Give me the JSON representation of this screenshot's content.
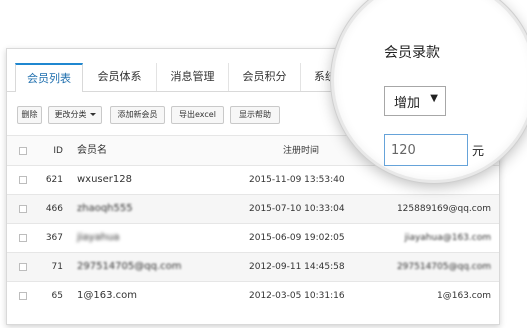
{
  "tabs": [
    "会员列表",
    "会员体系",
    "消息管理",
    "会员积分",
    "系统设"
  ],
  "toolbar": {
    "delete": "删除",
    "change_category": "更改分类",
    "add_member": "添加新会员",
    "export": "导出excel",
    "help": "显示帮助"
  },
  "table": {
    "headers": {
      "id": "ID",
      "name": "会员名",
      "time": "注册时间",
      "email": ""
    },
    "rows": [
      {
        "id": "621",
        "name": "wxuser128",
        "time": "2015-11-09 13:53:40",
        "email": ""
      },
      {
        "id": "466",
        "name": "zhaoqh555",
        "time": "2015-07-10 10:33:04",
        "email": "125889169@qq.com"
      },
      {
        "id": "367",
        "name": "jiayahua",
        "time": "2015-06-09 19:02:05",
        "email": "jiayahua@163.com"
      },
      {
        "id": "71",
        "name": "297514705@qq.com",
        "time": "2012-09-11 14:45:58",
        "email": "297514705@qq.com"
      },
      {
        "id": "65",
        "name": "1@163.com",
        "time": "2012-03-05 10:31:16",
        "email": "1@163.com"
      }
    ]
  },
  "recharge": {
    "title": "会员录款",
    "select_value": "增加",
    "arrow": "▼",
    "amount": "120",
    "unit": "元"
  }
}
